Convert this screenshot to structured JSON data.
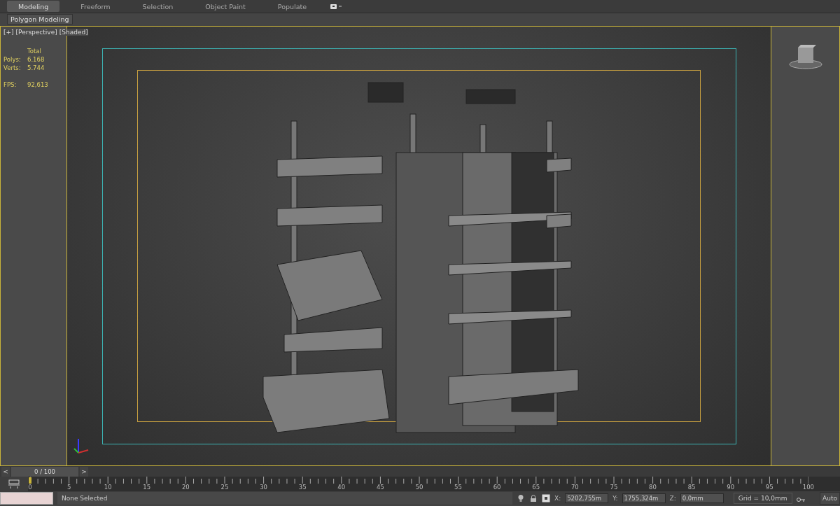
{
  "ribbon": {
    "tabs": [
      {
        "label": "Modeling",
        "selected": true
      },
      {
        "label": "Freeform",
        "selected": false
      },
      {
        "label": "Selection",
        "selected": false
      },
      {
        "label": "Object Paint",
        "selected": false
      },
      {
        "label": "Populate",
        "selected": false
      }
    ],
    "panel_label": "Polygon Modeling"
  },
  "viewport": {
    "labels": [
      "[+]",
      "[Perspective]",
      "[Shaded]"
    ],
    "stats": {
      "header": "Total",
      "rows": [
        {
          "label": "Polys:",
          "value": "6.168"
        },
        {
          "label": "Verts:",
          "value": "5.744"
        }
      ],
      "fps_label": "FPS:",
      "fps_value": "92,613"
    }
  },
  "timeline": {
    "prev": "<",
    "position": "0 / 100",
    "next": ">",
    "level": 0,
    "ticks": [
      "0",
      "5",
      "10",
      "15",
      "20",
      "25",
      "30",
      "35",
      "40",
      "45",
      "50",
      "55",
      "60",
      "65",
      "70",
      "75",
      "80",
      "85",
      "90",
      "95",
      "100"
    ]
  },
  "status_bar": {
    "selection": "None Selected",
    "coords": [
      {
        "axis": "X:",
        "value": "5202,755m"
      },
      {
        "axis": "Y:",
        "value": "1755,324m"
      },
      {
        "axis": "Z:",
        "value": "0,0mm"
      }
    ],
    "grid": "Grid = 10,0mm",
    "auto": "Auto"
  }
}
